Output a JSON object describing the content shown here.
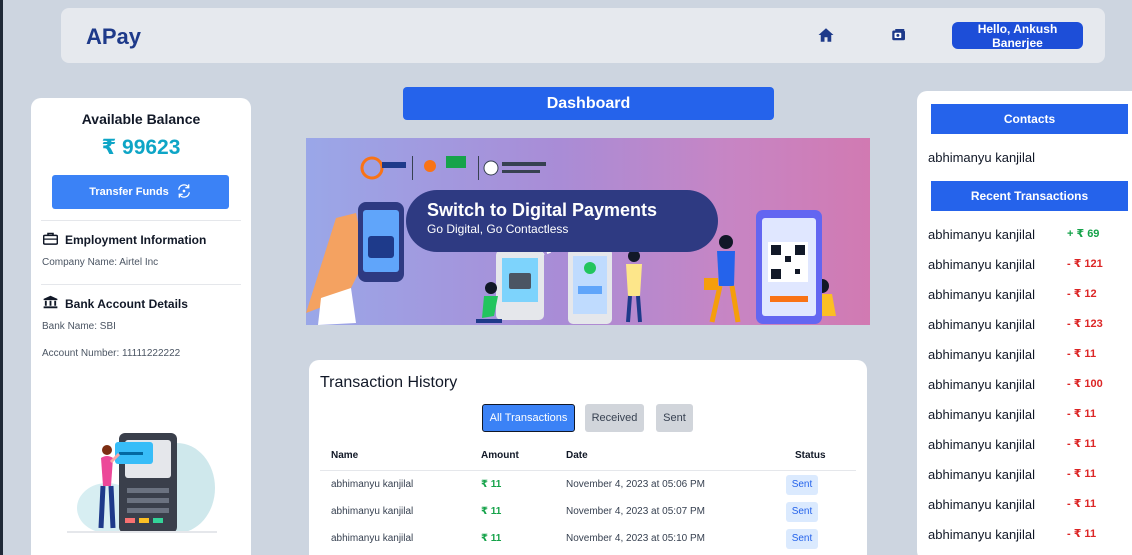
{
  "navbar": {
    "brand": "APay",
    "home_icon": "home-icon",
    "wallet_icon": "wallet-icon",
    "greeting": "Hello, Ankush Banerjee"
  },
  "left": {
    "balance_label": "Available Balance",
    "balance_value": "₹ 99623",
    "transfer_label": "Transfer Funds",
    "transfer_icon": "transfer-refresh-icon",
    "employment_title": "Employment Information",
    "company": "Company Name: Airtel Inc",
    "bank_title": "Bank Account Details",
    "bank_name": "Bank Name: SBI",
    "account_number": "Account Number: 11111222222"
  },
  "center": {
    "dashboard_label": "Dashboard",
    "banner": {
      "title": "Switch to Digital Payments",
      "subtitle": "Go Digital, Go Contactless"
    }
  },
  "history": {
    "title": "Transaction History",
    "filters": [
      "All Transactions",
      "Received",
      "Sent"
    ],
    "columns": [
      "Name",
      "Amount",
      "Date",
      "Status"
    ],
    "rows": [
      {
        "name": "abhimanyu kanjilal",
        "amount": "₹ 11",
        "date": "November 4, 2023 at 05:06 PM",
        "status": "Sent"
      },
      {
        "name": "abhimanyu kanjilal",
        "amount": "₹ 11",
        "date": "November 4, 2023 at 05:07 PM",
        "status": "Sent"
      },
      {
        "name": "abhimanyu kanjilal",
        "amount": "₹ 11",
        "date": "November 4, 2023 at 05:10 PM",
        "status": "Sent"
      }
    ]
  },
  "right": {
    "contacts_title": "Contacts",
    "contacts": [
      "abhimanyu kanjilal"
    ],
    "recent_title": "Recent Transactions",
    "recent": [
      {
        "name": "abhimanyu kanjilal",
        "amount": "+ ₹ 69",
        "direction": "in"
      },
      {
        "name": "abhimanyu kanjilal",
        "amount": "- ₹ 121",
        "direction": "out"
      },
      {
        "name": "abhimanyu kanjilal",
        "amount": "- ₹ 12",
        "direction": "out"
      },
      {
        "name": "abhimanyu kanjilal",
        "amount": "- ₹ 123",
        "direction": "out"
      },
      {
        "name": "abhimanyu kanjilal",
        "amount": "- ₹ 11",
        "direction": "out"
      },
      {
        "name": "abhimanyu kanjilal",
        "amount": "- ₹ 100",
        "direction": "out"
      },
      {
        "name": "abhimanyu kanjilal",
        "amount": "- ₹ 11",
        "direction": "out"
      },
      {
        "name": "abhimanyu kanjilal",
        "amount": "- ₹ 11",
        "direction": "out"
      },
      {
        "name": "abhimanyu kanjilal",
        "amount": "- ₹ 11",
        "direction": "out"
      },
      {
        "name": "abhimanyu kanjilal",
        "amount": "- ₹ 11",
        "direction": "out"
      },
      {
        "name": "abhimanyu kanjilal",
        "amount": "- ₹ 11",
        "direction": "out"
      }
    ]
  },
  "colors": {
    "background": "#cdd5e0",
    "primary": "#2563eb",
    "balance": "#0ea5c6",
    "credit": "#16a34a",
    "debit": "#dc2626"
  }
}
